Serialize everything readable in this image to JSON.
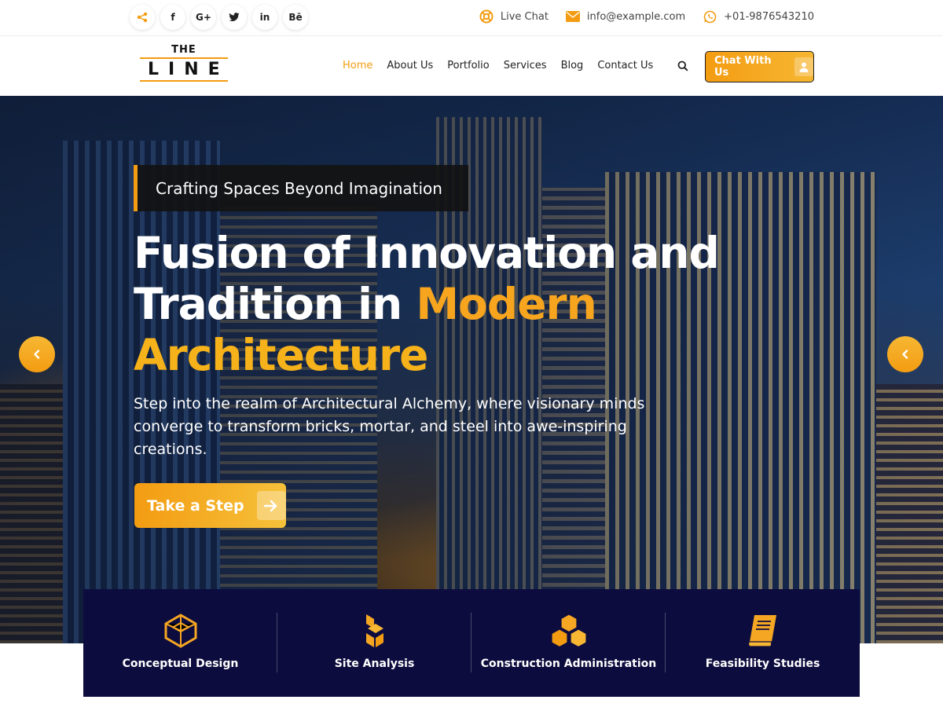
{
  "topbar": {
    "socials": [
      {
        "icon": "share-icon",
        "glyph": ""
      },
      {
        "icon": "facebook-icon",
        "glyph": "f"
      },
      {
        "icon": "google-plus-icon",
        "glyph": "G+"
      },
      {
        "icon": "twitter-icon",
        "glyph": ""
      },
      {
        "icon": "linkedin-icon",
        "glyph": "in"
      },
      {
        "icon": "behance-icon",
        "glyph": "Bē"
      }
    ],
    "live_chat": "Live Chat",
    "email": "info@example.com",
    "phone": "+01-9876543210"
  },
  "header": {
    "logo_top": "THE",
    "logo_main": "LINE",
    "nav": [
      "Home",
      "About Us",
      "Portfolio",
      "Services",
      "Blog",
      "Contact Us"
    ],
    "active_nav": "Home",
    "chat_button": "Chat With Us"
  },
  "hero": {
    "tagline": "Crafting Spaces Beyond Imagination",
    "headline_part1": "Fusion of Innovation and Tradition in ",
    "headline_highlight1": "Modern",
    "headline_highlight2": "Architecture",
    "description": "Step into the realm of Architectural Alchemy, where visionary minds converge to transform bricks, mortar, and steel into awe-inspiring creations.",
    "cta_label": "Take a Step"
  },
  "services": [
    {
      "label": "Conceptual Design",
      "icon": "cube-outline-icon"
    },
    {
      "label": "Site Analysis",
      "icon": "stacked-blocks-icon"
    },
    {
      "label": "Construction Administration",
      "icon": "cubes-icon"
    },
    {
      "label": "Feasibility Studies",
      "icon": "book-icon"
    }
  ],
  "colors": {
    "accent": "#f39c12",
    "services_bg": "#0d0c3e"
  }
}
